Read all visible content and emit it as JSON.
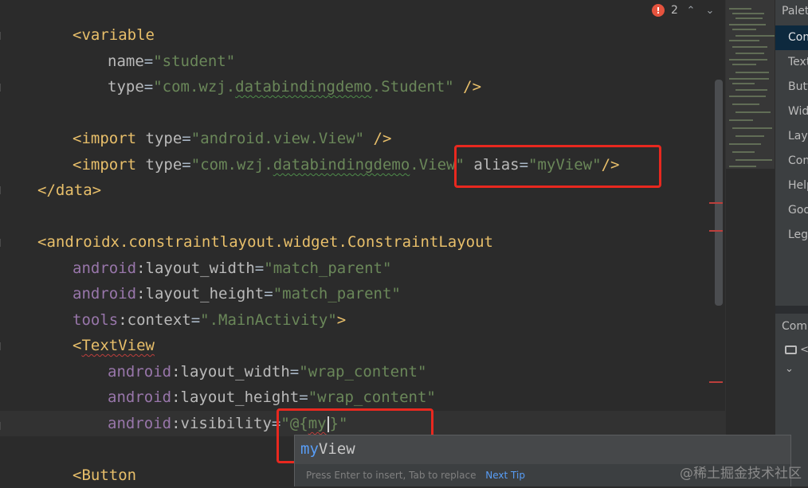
{
  "editor": {
    "lines": [
      {
        "parts": [
          [
            "bracket",
            "<"
          ],
          [
            "tag",
            "variable"
          ]
        ]
      },
      {
        "parts": [
          [
            "attr",
            "name"
          ],
          [
            "plain",
            "="
          ],
          [
            "str",
            "\"student\""
          ]
        ]
      },
      {
        "parts": [
          [
            "attr",
            "type"
          ],
          [
            "plain",
            "="
          ],
          [
            "str",
            "\"com.wzj."
          ],
          [
            "str squig",
            "databindingdemo"
          ],
          [
            "str",
            ".Student\""
          ],
          [
            "plain",
            " "
          ],
          [
            "bracket",
            "/>"
          ]
        ]
      },
      {
        "parts": [
          [
            "bracket",
            "<"
          ],
          [
            "tag",
            "import "
          ],
          [
            "attr",
            "type"
          ],
          [
            "plain",
            "="
          ],
          [
            "str",
            "\"android.view.View\""
          ],
          [
            "plain",
            " "
          ],
          [
            "bracket",
            "/>"
          ]
        ]
      },
      {
        "parts": [
          [
            "bracket",
            "<"
          ],
          [
            "tag",
            "import "
          ],
          [
            "attr",
            "type"
          ],
          [
            "plain",
            "="
          ],
          [
            "str",
            "\"com.wzj."
          ],
          [
            "str squig",
            "databindingdemo"
          ],
          [
            "str",
            ".View\""
          ],
          [
            "plain",
            " "
          ],
          [
            "attr",
            "alias"
          ],
          [
            "plain",
            "="
          ],
          [
            "str",
            "\"myView\""
          ],
          [
            "bracket",
            "/>"
          ]
        ]
      },
      {
        "parts": [
          [
            "bracket",
            "</"
          ],
          [
            "tag",
            "data"
          ],
          [
            "bracket",
            ">"
          ]
        ]
      },
      {
        "parts": [
          [
            "bracket",
            "<"
          ],
          [
            "tag",
            "androidx.constraintlayout.widget.ConstraintLayout"
          ]
        ]
      },
      {
        "parts": [
          [
            "ns",
            "android"
          ],
          [
            "attr",
            ":layout_width"
          ],
          [
            "plain",
            "="
          ],
          [
            "str",
            "\"match_parent\""
          ]
        ]
      },
      {
        "parts": [
          [
            "ns",
            "android"
          ],
          [
            "attr",
            ":layout_height"
          ],
          [
            "plain",
            "="
          ],
          [
            "str",
            "\"match_parent\""
          ]
        ]
      },
      {
        "parts": [
          [
            "ns",
            "tools"
          ],
          [
            "attr",
            ":context"
          ],
          [
            "plain",
            "="
          ],
          [
            "str",
            "\".MainActivity\""
          ],
          [
            "bracket",
            ">"
          ]
        ]
      },
      {
        "parts": [
          [
            "bracket",
            "<"
          ],
          [
            "tag squig-red",
            "TextView"
          ]
        ]
      },
      {
        "parts": [
          [
            "ns",
            "android"
          ],
          [
            "attr",
            ":layout_width"
          ],
          [
            "plain",
            "="
          ],
          [
            "str",
            "\"wrap_content\""
          ]
        ]
      },
      {
        "parts": [
          [
            "ns",
            "android"
          ],
          [
            "attr",
            ":layout_height"
          ],
          [
            "plain",
            "="
          ],
          [
            "str",
            "\"wrap_content\""
          ]
        ]
      },
      {
        "parts": [
          [
            "ns",
            "android"
          ],
          [
            "attr",
            ":visibility"
          ],
          [
            "plain",
            "="
          ],
          [
            "str",
            "\"@{"
          ],
          [
            "str squig-red",
            "my"
          ],
          [
            "caret",
            ""
          ],
          [
            "str",
            "}\""
          ]
        ]
      },
      {
        "parts": [
          [
            "bracket",
            "<"
          ],
          [
            "tag",
            "Button"
          ]
        ]
      }
    ]
  },
  "status": {
    "error_count": "2"
  },
  "palette": {
    "title": "Palette",
    "items": [
      "Common",
      "Text",
      "Buttons",
      "Widgets",
      "Layouts",
      "Containers",
      "Helpers",
      "Google",
      "Legacy"
    ],
    "component_tree_title": "Component Tree",
    "tree_row_1": "<",
    "tree_row_2": ""
  },
  "completion": {
    "match": "my",
    "rest": "View",
    "hint": "Press Enter to insert, Tab to replace",
    "next_tip": "Next Tip"
  },
  "watermark": "@稀土掘金技术社区",
  "colors": {
    "highlight_box": "#e8281f",
    "accent": "#589df6",
    "error": "#e5533e"
  }
}
